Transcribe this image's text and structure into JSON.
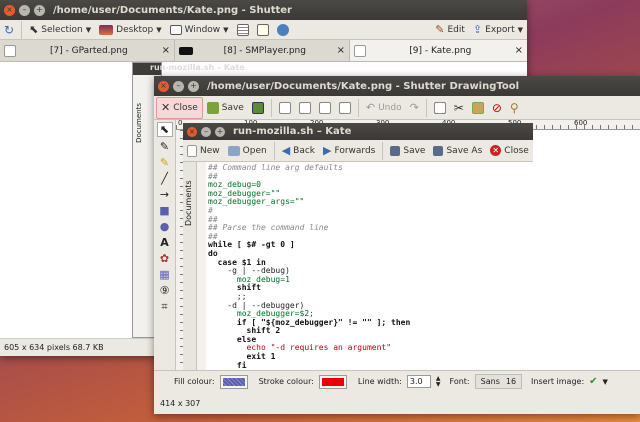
{
  "shutter": {
    "title": "/home/user/Documents/Kate.png - Shutter",
    "toolbar": {
      "selection": "Selection",
      "desktop": "Desktop",
      "window": "Window",
      "edit": "Edit",
      "export": "Export"
    },
    "tabs": [
      "[7] - GParted.png",
      "[8] - SMPlayer.png",
      "[9] - Kate.png"
    ],
    "status": "605 x 634 pixels  68.7 KB"
  },
  "kate_bg": {
    "title": "run-mozilla.sh – Kate",
    "documents": "Documents"
  },
  "drawing": {
    "title": "/home/user/Documents/Kate.png - Shutter DrawingTool",
    "toolbar": {
      "close": "Close",
      "save": "Save",
      "undo": "Undo"
    },
    "ruler": [
      "0",
      "100",
      "200",
      "300",
      "400",
      "500",
      "600"
    ],
    "bottom": {
      "fill_label": "Fill colour:",
      "stroke_label": "Stroke colour:",
      "line_width_label": "Line width:",
      "line_width": "3.0",
      "font_label": "Font:",
      "font_value": "Sans",
      "font_size": "16",
      "insert_label": "Insert image:"
    },
    "status": "414 x 307",
    "colors": {
      "fill": "#5b5fb0",
      "stroke": "#ee0000"
    }
  },
  "kate": {
    "title": "run-mozilla.sh – Kate",
    "documents": "Documents",
    "toolbar": {
      "new": "New",
      "open": "Open",
      "back": "Back",
      "forwards": "Forwards",
      "save": "Save",
      "save_as": "Save As",
      "close": "Close"
    },
    "code": [
      {
        "t": "## Command line arg defaults",
        "c": "comment"
      },
      {
        "t": "##",
        "c": "comment"
      },
      {
        "t": "moz_debug=0",
        "c": "var"
      },
      {
        "t": "moz_debugger=\"\"",
        "c": "var"
      },
      {
        "t": "moz_debugger_args=\"\"",
        "c": "var"
      },
      {
        "t": "#",
        "c": "comment"
      },
      {
        "t": "##",
        "c": "comment"
      },
      {
        "t": "## Parse the command line",
        "c": "comment"
      },
      {
        "t": "##",
        "c": "comment"
      },
      {
        "t": "while [ $# -gt 0 ]",
        "c": "kw"
      },
      {
        "t": "do",
        "c": "kw"
      },
      {
        "t": "  case $1 in",
        "c": "kw"
      },
      {
        "t": "    -g | --debug)",
        "c": "plain"
      },
      {
        "t": "      moz_debug=1",
        "c": "var"
      },
      {
        "t": "      shift",
        "c": "kw"
      },
      {
        "t": "      ;;",
        "c": "plain"
      },
      {
        "t": "    -d | --debugger)",
        "c": "plain"
      },
      {
        "t": "      moz_debugger=$2;",
        "c": "var"
      },
      {
        "t": "      if [ \"${moz_debugger}\" != \"\" ]; then",
        "c": "kw"
      },
      {
        "t": "        shift 2",
        "c": "kw"
      },
      {
        "t": "      else",
        "c": "kw"
      },
      {
        "t": "        echo \"-d requires an argument\"",
        "c": "str"
      },
      {
        "t": "        exit 1",
        "c": "kw"
      },
      {
        "t": "      fi",
        "c": "kw"
      }
    ]
  }
}
